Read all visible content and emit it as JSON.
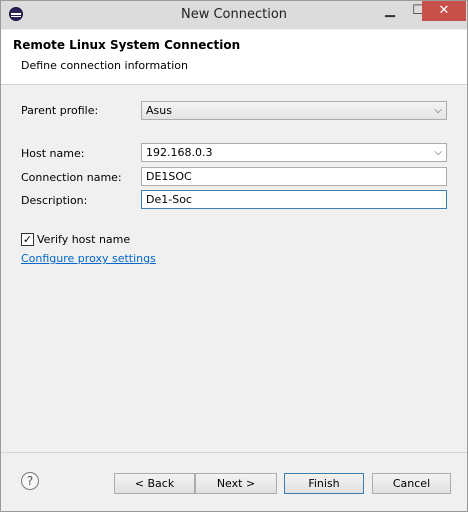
{
  "window": {
    "title": "New Connection",
    "minimize_glyph": "▁",
    "maximize_glyph": "☐",
    "close_glyph": "✕"
  },
  "header": {
    "title": "Remote Linux System Connection",
    "subtitle": "Define connection information"
  },
  "form": {
    "parent_profile": {
      "label": "Parent profile:",
      "value": "Asus"
    },
    "host_name": {
      "label": "Host name:",
      "value": "192.168.0.3"
    },
    "connection_name": {
      "label": "Connection name:",
      "value": "DE1SOC"
    },
    "description": {
      "label": "Description:",
      "value": "De1-Soc"
    },
    "verify_host": {
      "label": "Verify host name",
      "checked": true
    },
    "proxy_link": "Configure proxy settings"
  },
  "buttons": {
    "help": "?",
    "back": "< Back",
    "next": "Next >",
    "finish": "Finish",
    "cancel": "Cancel"
  }
}
